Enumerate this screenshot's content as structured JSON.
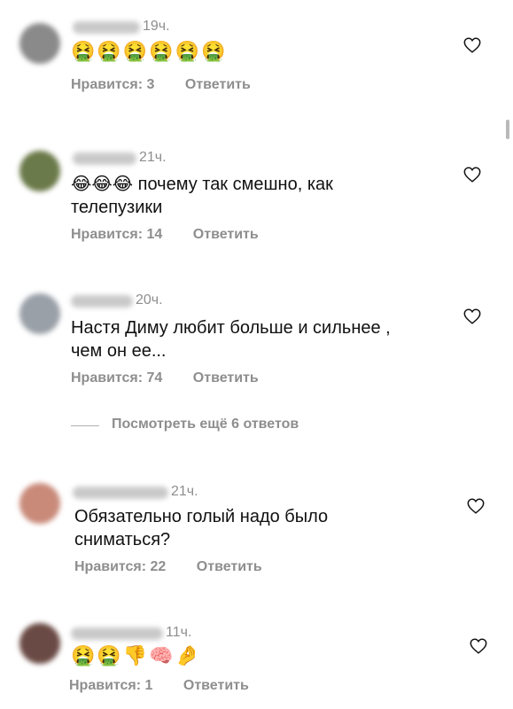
{
  "comments": [
    {
      "time": "19ч.",
      "text": "🤮🤮🤮🤮🤮🤮",
      "likes": "Нравится: 3",
      "reply": "Ответить"
    },
    {
      "time": "21ч.",
      "text": "😂😂😂 почему так смешно, как телепузики",
      "likes": "Нравится: 14",
      "reply": "Ответить"
    },
    {
      "time": "20ч.",
      "text": "Настя Диму любит больше и сильнее , чем он ее...",
      "likes": "Нравится: 74",
      "reply": "Ответить"
    },
    {
      "time": "21ч.",
      "text": "Обязательно голый надо было сниматься?",
      "likes": "Нравится: 22",
      "reply": "Ответить"
    },
    {
      "time": "11ч.",
      "text": "🤮🤮👎🧠🤌",
      "likes": "Нравится: 1",
      "reply": "Ответить"
    }
  ],
  "view_more": "Посмотреть ещё 6 ответов",
  "colors": {
    "secondary_text": "#8e8e8e",
    "avatar_1": "#8a8a8a",
    "avatar_2": "#6b7a4a",
    "avatar_3": "#9aa0a8",
    "avatar_4": "#c98a7a",
    "avatar_5": "#6a4a44"
  },
  "icons": [
    "heart-icon"
  ]
}
